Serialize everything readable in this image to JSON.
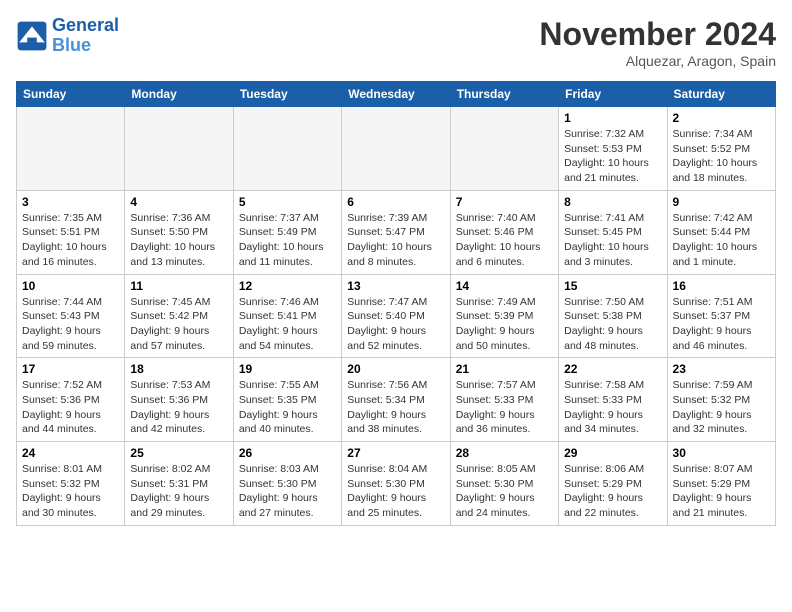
{
  "header": {
    "logo_line1": "General",
    "logo_line2": "Blue",
    "month": "November 2024",
    "location": "Alquezar, Aragon, Spain"
  },
  "days_of_week": [
    "Sunday",
    "Monday",
    "Tuesday",
    "Wednesday",
    "Thursday",
    "Friday",
    "Saturday"
  ],
  "weeks": [
    [
      {
        "day": "",
        "info": ""
      },
      {
        "day": "",
        "info": ""
      },
      {
        "day": "",
        "info": ""
      },
      {
        "day": "",
        "info": ""
      },
      {
        "day": "",
        "info": ""
      },
      {
        "day": "1",
        "info": "Sunrise: 7:32 AM\nSunset: 5:53 PM\nDaylight: 10 hours\nand 21 minutes."
      },
      {
        "day": "2",
        "info": "Sunrise: 7:34 AM\nSunset: 5:52 PM\nDaylight: 10 hours\nand 18 minutes."
      }
    ],
    [
      {
        "day": "3",
        "info": "Sunrise: 7:35 AM\nSunset: 5:51 PM\nDaylight: 10 hours\nand 16 minutes."
      },
      {
        "day": "4",
        "info": "Sunrise: 7:36 AM\nSunset: 5:50 PM\nDaylight: 10 hours\nand 13 minutes."
      },
      {
        "day": "5",
        "info": "Sunrise: 7:37 AM\nSunset: 5:49 PM\nDaylight: 10 hours\nand 11 minutes."
      },
      {
        "day": "6",
        "info": "Sunrise: 7:39 AM\nSunset: 5:47 PM\nDaylight: 10 hours\nand 8 minutes."
      },
      {
        "day": "7",
        "info": "Sunrise: 7:40 AM\nSunset: 5:46 PM\nDaylight: 10 hours\nand 6 minutes."
      },
      {
        "day": "8",
        "info": "Sunrise: 7:41 AM\nSunset: 5:45 PM\nDaylight: 10 hours\nand 3 minutes."
      },
      {
        "day": "9",
        "info": "Sunrise: 7:42 AM\nSunset: 5:44 PM\nDaylight: 10 hours\nand 1 minute."
      }
    ],
    [
      {
        "day": "10",
        "info": "Sunrise: 7:44 AM\nSunset: 5:43 PM\nDaylight: 9 hours\nand 59 minutes."
      },
      {
        "day": "11",
        "info": "Sunrise: 7:45 AM\nSunset: 5:42 PM\nDaylight: 9 hours\nand 57 minutes."
      },
      {
        "day": "12",
        "info": "Sunrise: 7:46 AM\nSunset: 5:41 PM\nDaylight: 9 hours\nand 54 minutes."
      },
      {
        "day": "13",
        "info": "Sunrise: 7:47 AM\nSunset: 5:40 PM\nDaylight: 9 hours\nand 52 minutes."
      },
      {
        "day": "14",
        "info": "Sunrise: 7:49 AM\nSunset: 5:39 PM\nDaylight: 9 hours\nand 50 minutes."
      },
      {
        "day": "15",
        "info": "Sunrise: 7:50 AM\nSunset: 5:38 PM\nDaylight: 9 hours\nand 48 minutes."
      },
      {
        "day": "16",
        "info": "Sunrise: 7:51 AM\nSunset: 5:37 PM\nDaylight: 9 hours\nand 46 minutes."
      }
    ],
    [
      {
        "day": "17",
        "info": "Sunrise: 7:52 AM\nSunset: 5:36 PM\nDaylight: 9 hours\nand 44 minutes."
      },
      {
        "day": "18",
        "info": "Sunrise: 7:53 AM\nSunset: 5:36 PM\nDaylight: 9 hours\nand 42 minutes."
      },
      {
        "day": "19",
        "info": "Sunrise: 7:55 AM\nSunset: 5:35 PM\nDaylight: 9 hours\nand 40 minutes."
      },
      {
        "day": "20",
        "info": "Sunrise: 7:56 AM\nSunset: 5:34 PM\nDaylight: 9 hours\nand 38 minutes."
      },
      {
        "day": "21",
        "info": "Sunrise: 7:57 AM\nSunset: 5:33 PM\nDaylight: 9 hours\nand 36 minutes."
      },
      {
        "day": "22",
        "info": "Sunrise: 7:58 AM\nSunset: 5:33 PM\nDaylight: 9 hours\nand 34 minutes."
      },
      {
        "day": "23",
        "info": "Sunrise: 7:59 AM\nSunset: 5:32 PM\nDaylight: 9 hours\nand 32 minutes."
      }
    ],
    [
      {
        "day": "24",
        "info": "Sunrise: 8:01 AM\nSunset: 5:32 PM\nDaylight: 9 hours\nand 30 minutes."
      },
      {
        "day": "25",
        "info": "Sunrise: 8:02 AM\nSunset: 5:31 PM\nDaylight: 9 hours\nand 29 minutes."
      },
      {
        "day": "26",
        "info": "Sunrise: 8:03 AM\nSunset: 5:30 PM\nDaylight: 9 hours\nand 27 minutes."
      },
      {
        "day": "27",
        "info": "Sunrise: 8:04 AM\nSunset: 5:30 PM\nDaylight: 9 hours\nand 25 minutes."
      },
      {
        "day": "28",
        "info": "Sunrise: 8:05 AM\nSunset: 5:30 PM\nDaylight: 9 hours\nand 24 minutes."
      },
      {
        "day": "29",
        "info": "Sunrise: 8:06 AM\nSunset: 5:29 PM\nDaylight: 9 hours\nand 22 minutes."
      },
      {
        "day": "30",
        "info": "Sunrise: 8:07 AM\nSunset: 5:29 PM\nDaylight: 9 hours\nand 21 minutes."
      }
    ]
  ]
}
